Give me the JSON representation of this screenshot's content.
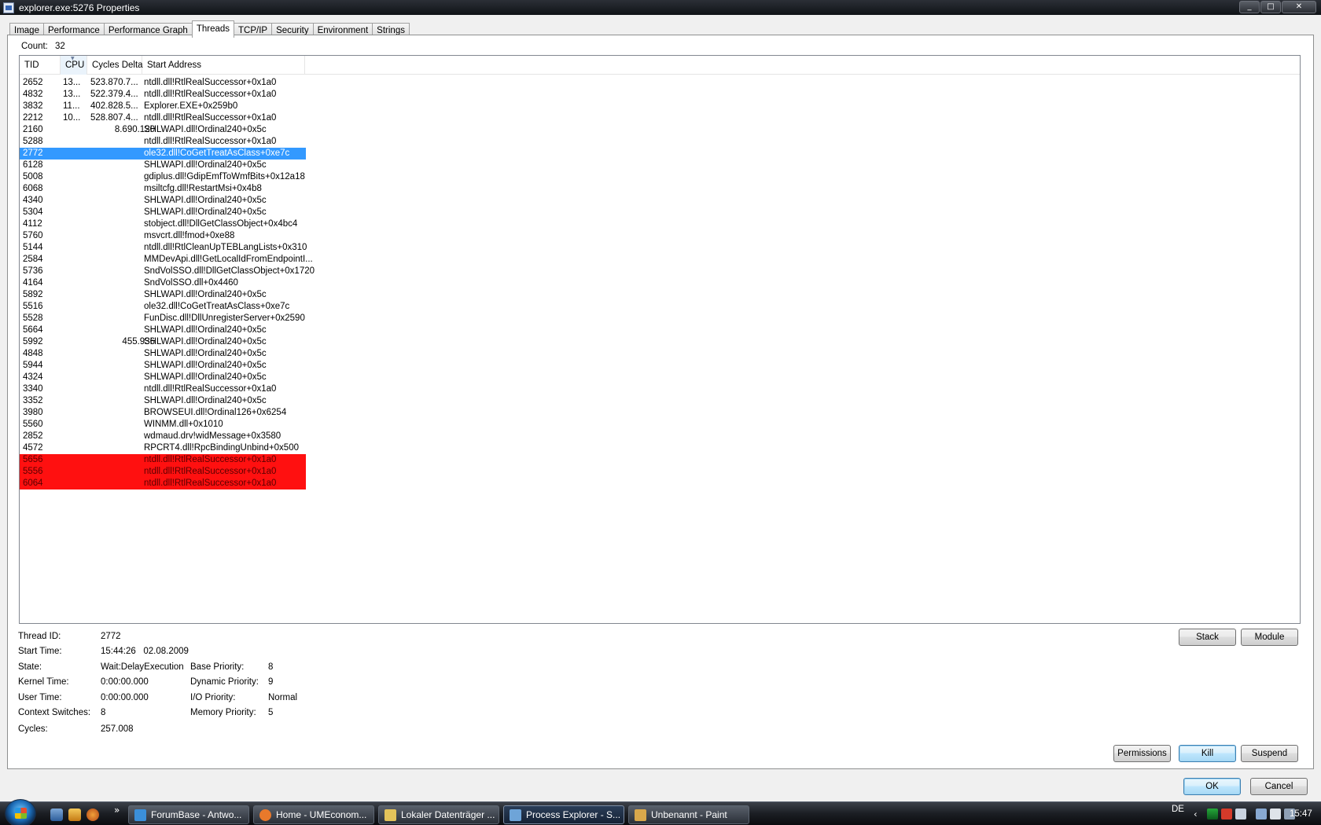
{
  "window": {
    "title": "explorer.exe:5276 Properties",
    "min": "_",
    "max": "□",
    "close": "✕"
  },
  "tabs": [
    "Image",
    "Performance",
    "Performance Graph",
    "Threads",
    "TCP/IP",
    "Security",
    "Environment",
    "Strings"
  ],
  "count": {
    "label": "Count:",
    "value": "32"
  },
  "columns": {
    "tid": "TID",
    "cpu": "CPU",
    "cycles": "Cycles Delta",
    "address": "Start Address"
  },
  "rows": [
    {
      "tid": "2652",
      "cpu": "13...",
      "cycles": "523.870.7...",
      "address": "ntdll.dll!RtlRealSuccessor+0x1a0",
      "state": "normal"
    },
    {
      "tid": "4832",
      "cpu": "13...",
      "cycles": "522.379.4...",
      "address": "ntdll.dll!RtlRealSuccessor+0x1a0",
      "state": "normal"
    },
    {
      "tid": "3832",
      "cpu": "11...",
      "cycles": "402.828.5...",
      "address": "Explorer.EXE+0x259b0",
      "state": "normal"
    },
    {
      "tid": "2212",
      "cpu": "10...",
      "cycles": "528.807.4...",
      "address": "ntdll.dll!RtlRealSuccessor+0x1a0",
      "state": "normal"
    },
    {
      "tid": "2160",
      "cpu": "",
      "cycles": "8.690.120",
      "address": "SHLWAPI.dll!Ordinal240+0x5c",
      "state": "normal"
    },
    {
      "tid": "5288",
      "cpu": "",
      "cycles": "",
      "address": "ntdll.dll!RtlRealSuccessor+0x1a0",
      "state": "normal"
    },
    {
      "tid": "2772",
      "cpu": "",
      "cycles": "",
      "address": "ole32.dll!CoGetTreatAsClass+0xe7c",
      "state": "selected"
    },
    {
      "tid": "6128",
      "cpu": "",
      "cycles": "",
      "address": "SHLWAPI.dll!Ordinal240+0x5c",
      "state": "normal"
    },
    {
      "tid": "5008",
      "cpu": "",
      "cycles": "",
      "address": "gdiplus.dll!GdipEmfToWmfBits+0x12a18",
      "state": "normal"
    },
    {
      "tid": "6068",
      "cpu": "",
      "cycles": "",
      "address": "msiltcfg.dll!RestartMsi+0x4b8",
      "state": "normal"
    },
    {
      "tid": "4340",
      "cpu": "",
      "cycles": "",
      "address": "SHLWAPI.dll!Ordinal240+0x5c",
      "state": "normal"
    },
    {
      "tid": "5304",
      "cpu": "",
      "cycles": "",
      "address": "SHLWAPI.dll!Ordinal240+0x5c",
      "state": "normal"
    },
    {
      "tid": "4112",
      "cpu": "",
      "cycles": "",
      "address": "stobject.dll!DllGetClassObject+0x4bc4",
      "state": "normal"
    },
    {
      "tid": "5760",
      "cpu": "",
      "cycles": "",
      "address": "msvcrt.dll!fmod+0xe88",
      "state": "normal"
    },
    {
      "tid": "5144",
      "cpu": "",
      "cycles": "",
      "address": "ntdll.dll!RtlCleanUpTEBLangLists+0x310",
      "state": "normal"
    },
    {
      "tid": "2584",
      "cpu": "",
      "cycles": "",
      "address": "MMDevApi.dll!GetLocalIdFromEndpointI...",
      "state": "normal"
    },
    {
      "tid": "5736",
      "cpu": "",
      "cycles": "",
      "address": "SndVolSSO.dll!DllGetClassObject+0x1720",
      "state": "normal"
    },
    {
      "tid": "4164",
      "cpu": "",
      "cycles": "",
      "address": "SndVolSSO.dll+0x4460",
      "state": "normal"
    },
    {
      "tid": "5892",
      "cpu": "",
      "cycles": "",
      "address": "SHLWAPI.dll!Ordinal240+0x5c",
      "state": "normal"
    },
    {
      "tid": "5516",
      "cpu": "",
      "cycles": "",
      "address": "ole32.dll!CoGetTreatAsClass+0xe7c",
      "state": "normal"
    },
    {
      "tid": "5528",
      "cpu": "",
      "cycles": "",
      "address": "FunDisc.dll!DllUnregisterServer+0x2590",
      "state": "normal"
    },
    {
      "tid": "5664",
      "cpu": "",
      "cycles": "",
      "address": "SHLWAPI.dll!Ordinal240+0x5c",
      "state": "normal"
    },
    {
      "tid": "5992",
      "cpu": "",
      "cycles": "455.936",
      "address": "SHLWAPI.dll!Ordinal240+0x5c",
      "state": "normal"
    },
    {
      "tid": "4848",
      "cpu": "",
      "cycles": "",
      "address": "SHLWAPI.dll!Ordinal240+0x5c",
      "state": "normal"
    },
    {
      "tid": "5944",
      "cpu": "",
      "cycles": "",
      "address": "SHLWAPI.dll!Ordinal240+0x5c",
      "state": "normal"
    },
    {
      "tid": "4324",
      "cpu": "",
      "cycles": "",
      "address": "SHLWAPI.dll!Ordinal240+0x5c",
      "state": "normal"
    },
    {
      "tid": "3340",
      "cpu": "",
      "cycles": "",
      "address": "ntdll.dll!RtlRealSuccessor+0x1a0",
      "state": "normal"
    },
    {
      "tid": "3352",
      "cpu": "",
      "cycles": "",
      "address": "SHLWAPI.dll!Ordinal240+0x5c",
      "state": "normal"
    },
    {
      "tid": "3980",
      "cpu": "",
      "cycles": "",
      "address": "BROWSEUI.dll!Ordinal126+0x6254",
      "state": "normal"
    },
    {
      "tid": "5560",
      "cpu": "",
      "cycles": "",
      "address": "WINMM.dll+0x1010",
      "state": "normal"
    },
    {
      "tid": "2852",
      "cpu": "",
      "cycles": "",
      "address": "wdmaud.drv!widMessage+0x3580",
      "state": "normal"
    },
    {
      "tid": "4572",
      "cpu": "",
      "cycles": "",
      "address": "RPCRT4.dll!RpcBindingUnbind+0x500",
      "state": "normal"
    },
    {
      "tid": "5656",
      "cpu": "",
      "cycles": "",
      "address": "ntdll.dll!RtlRealSuccessor+0x1a0",
      "state": "terminated"
    },
    {
      "tid": "5556",
      "cpu": "",
      "cycles": "",
      "address": "ntdll.dll!RtlRealSuccessor+0x1a0",
      "state": "terminated"
    },
    {
      "tid": "6064",
      "cpu": "",
      "cycles": "",
      "address": "ntdll.dll!RtlRealSuccessor+0x1a0",
      "state": "terminated"
    }
  ],
  "details": {
    "thread_id_label": "Thread ID:",
    "thread_id": "2772",
    "start_time_label": "Start Time:",
    "start_time": "15:44:26   02.08.2009",
    "state_label": "State:",
    "state": "Wait:DelayExecution",
    "kernel_time_label": "Kernel Time:",
    "kernel_time": "0:00:00.000",
    "user_time_label": "User Time:",
    "user_time": "0:00:00.000",
    "context_switches_label": "Context Switches:",
    "context_switches": "8",
    "cycles_label": "Cycles:",
    "cycles": "257.008",
    "base_priority_label": "Base Priority:",
    "base_priority": "8",
    "dynamic_priority_label": "Dynamic Priority:",
    "dynamic_priority": "9",
    "io_priority_label": "I/O Priority:",
    "io_priority": "Normal",
    "memory_priority_label": "Memory Priority:",
    "memory_priority": "5"
  },
  "buttons": {
    "stack": "Stack",
    "module": "Module",
    "permissions": "Permissions",
    "kill": "Kill",
    "suspend": "Suspend",
    "ok": "OK",
    "cancel": "Cancel"
  },
  "taskbar": {
    "overflow": "»",
    "tasks": [
      {
        "label": "ForumBase - Antwo...",
        "icon": "ie-icon",
        "color": "#3b8fd9"
      },
      {
        "label": "Home - UMEconom...",
        "icon": "firefox-icon",
        "color": "#e8792b"
      },
      {
        "label": "Lokaler Datenträger ...",
        "icon": "folder-icon",
        "color": "#e3c35a"
      },
      {
        "label": "Process Explorer - S...",
        "icon": "process-explorer-icon",
        "color": "#6ea4d8"
      },
      {
        "label": "Unbenannt - Paint",
        "icon": "paint-icon",
        "color": "#d9a84b"
      }
    ],
    "language": "DE",
    "tray_chevron": "‹",
    "clock": "15:47"
  }
}
